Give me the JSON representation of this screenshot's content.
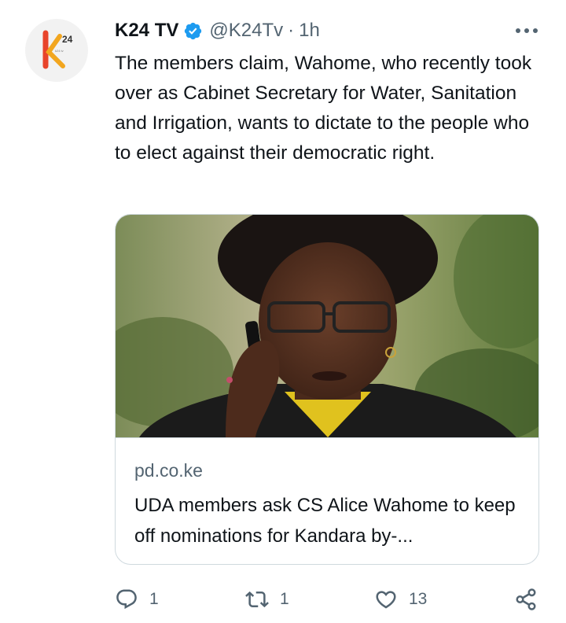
{
  "tweet": {
    "avatar": {
      "icon": "k24-logo",
      "brand_color": "#e8442b",
      "logo_tagline": "k24 tv"
    },
    "display_name": "K24 TV",
    "verified_icon": "verified-badge-icon",
    "handle": "@K24Tv",
    "separator": "·",
    "time": "1h",
    "text": "The members claim, Wahome, who recently took over as Cabinet Secretary for Water, Sanitation and Irrigation, wants to dictate to the people who to elect against their democratic right."
  },
  "card": {
    "domain": "pd.co.ke",
    "title": "UDA members ask CS Alice Wahome to keep off nominations for Kandara by-..."
  },
  "actions": {
    "reply": {
      "icon": "reply-icon",
      "count": "1"
    },
    "retweet": {
      "icon": "retweet-icon",
      "count": "1"
    },
    "like": {
      "icon": "heart-icon",
      "count": "13"
    },
    "share": {
      "icon": "share-icon"
    }
  },
  "colors": {
    "text": "#0f1419",
    "secondary": "#536471",
    "verified": "#1d9bf0",
    "border": "#cfd9de"
  }
}
